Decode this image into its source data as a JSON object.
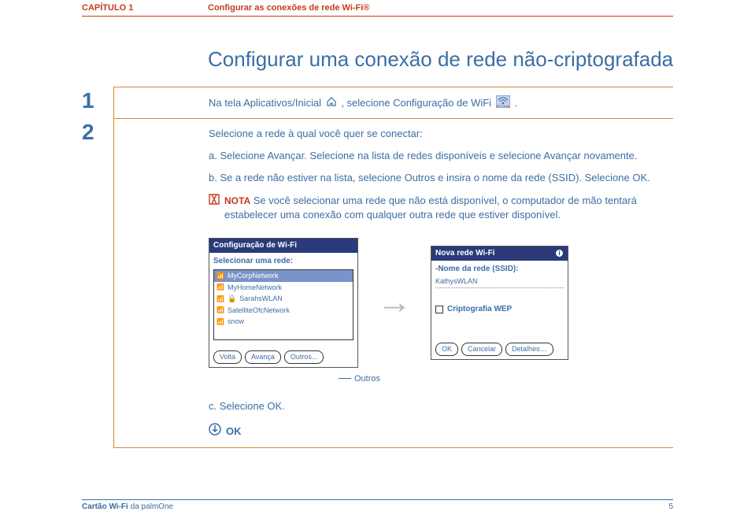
{
  "header": {
    "chapter": "CAPÍTULO 1",
    "subtitle": "Configurar as conexões de rede Wi-Fi®"
  },
  "title": "Configurar uma conexão de rede não-criptografada",
  "step1": {
    "num": "1",
    "text_a": "Na tela Aplicativos/Inicial ",
    "text_b": ", selecione Configuração de WiFi ",
    "text_c": "."
  },
  "step2": {
    "num": "2",
    "intro": "Selecione a rede à qual você quer se conectar:",
    "item_a": "a. Selecione Avançar. Selecione na lista de redes disponíveis e selecione Avançar novamente.",
    "item_b": "b. Se a rede não estiver na lista, selecione Outros e insira o nome da rede (SSID). Selecione OK.",
    "nota_label": "NOTA",
    "nota_text": "Se você selecionar uma rede que não está disponível, o computador de mão tentará estabelecer uma conexão com qualquer outra rede que estiver disponível.",
    "item_c": "c. Selecione OK.",
    "ok_final": "OK",
    "outros_label": "Outros"
  },
  "screen1": {
    "title": "Configuração de Wi-Fi",
    "list_label": "Selecionar uma rede:",
    "nets": [
      {
        "name": "MyCorpNetwork",
        "selected": true
      },
      {
        "name": "MyHomeNetwork",
        "selected": false
      },
      {
        "name": "SarahsWLAN",
        "selected": false
      },
      {
        "name": "SatelliteOfcNetwork",
        "selected": false
      },
      {
        "name": "snow",
        "selected": false
      }
    ],
    "btn_back": "Volta",
    "btn_next": "Avança",
    "btn_other": "Outros..."
  },
  "screen2": {
    "title": "Nova rede Wi-Fi",
    "ssid_label": "-Nome da rede (SSID):",
    "ssid_value": "KathysWLAN",
    "wep_label": "Criptografia WEP",
    "btn_ok": "OK",
    "btn_cancel": "Cancelar",
    "btn_details": "Detalhes…"
  },
  "footer": {
    "left_bold": "Cartão Wi-Fi",
    "left_rest": " da palmOne",
    "page": "5"
  }
}
